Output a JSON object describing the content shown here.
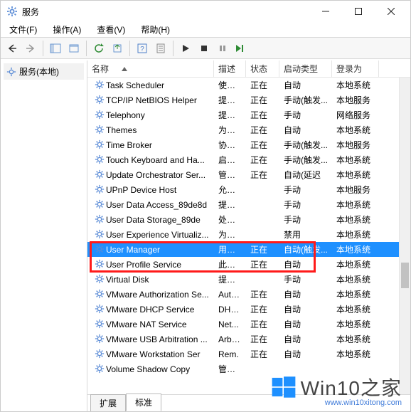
{
  "window": {
    "title": "服务"
  },
  "menu": {
    "file": "文件(F)",
    "action": "操作(A)",
    "view": "查看(V)",
    "help": "帮助(H)"
  },
  "tree": {
    "root": "服务(本地)"
  },
  "columns": {
    "name": "名称",
    "desc": "描述",
    "status": "状态",
    "startup": "启动类型",
    "logon": "登录为"
  },
  "tabs": {
    "extended": "扩展",
    "standard": "标准"
  },
  "rows": [
    {
      "name": "Task Scheduler",
      "desc": "使用...",
      "status": "正在",
      "startup": "自动",
      "logon": "本地系统"
    },
    {
      "name": "TCP/IP NetBIOS Helper",
      "desc": "提供 ...",
      "status": "正在",
      "startup": "手动(触发...",
      "logon": "本地服务"
    },
    {
      "name": "Telephony",
      "desc": "提供...",
      "status": "正在",
      "startup": "手动",
      "logon": "网络服务"
    },
    {
      "name": "Themes",
      "desc": "为用...",
      "status": "正在",
      "startup": "自动",
      "logon": "本地系统"
    },
    {
      "name": "Time Broker",
      "desc": "协调...",
      "status": "正在",
      "startup": "手动(触发...",
      "logon": "本地服务"
    },
    {
      "name": "Touch Keyboard and Ha...",
      "desc": "启用...",
      "status": "正在",
      "startup": "手动(触发...",
      "logon": "本地系统"
    },
    {
      "name": "Update Orchestrator Ser...",
      "desc": "管理...",
      "status": "正在",
      "startup": "自动(延迟",
      "logon": "本地系统"
    },
    {
      "name": "UPnP Device Host",
      "desc": "允许...",
      "status": "",
      "startup": "手动",
      "logon": "本地服务"
    },
    {
      "name": "User Data Access_89de8d",
      "desc": "提供...",
      "status": "",
      "startup": "手动",
      "logon": "本地系统"
    },
    {
      "name": "User Data Storage_89de",
      "desc": "处理...",
      "status": "",
      "startup": "手动",
      "logon": "本地系统"
    },
    {
      "name": "User Experience Virtualiz...",
      "desc": "为应...",
      "status": "",
      "startup": "禁用",
      "logon": "本地系统"
    },
    {
      "name": "User Manager",
      "desc": "用户...",
      "status": "正在",
      "startup": "自动(触发...",
      "logon": "本地系统",
      "selected": true
    },
    {
      "name": "User Profile Service",
      "desc": "此服...",
      "status": "正在",
      "startup": "自动",
      "logon": "本地系统"
    },
    {
      "name": "Virtual Disk",
      "desc": "提供...",
      "status": "",
      "startup": "手动",
      "logon": "本地系统"
    },
    {
      "name": "VMware Authorization Se...",
      "desc": "Auth...",
      "status": "正在",
      "startup": "自动",
      "logon": "本地系统"
    },
    {
      "name": "VMware DHCP Service",
      "desc": "DHC...",
      "status": "正在",
      "startup": "自动",
      "logon": "本地系统"
    },
    {
      "name": "VMware NAT Service",
      "desc": "Net...",
      "status": "正在",
      "startup": "自动",
      "logon": "本地系统"
    },
    {
      "name": "VMware USB Arbitration ...",
      "desc": "Arbit...",
      "status": "正在",
      "startup": "自动",
      "logon": "本地系统"
    },
    {
      "name": "VMware Workstation Ser",
      "desc": "Rem.",
      "status": "正在",
      "startup": "自动",
      "logon": "本地系统"
    },
    {
      "name": "Volume Shadow Copy",
      "desc": "管理...",
      "status": "",
      "startup": "",
      "logon": ""
    }
  ],
  "watermark": {
    "text": "Win10之家",
    "sub": "www.win10xitong.com"
  }
}
